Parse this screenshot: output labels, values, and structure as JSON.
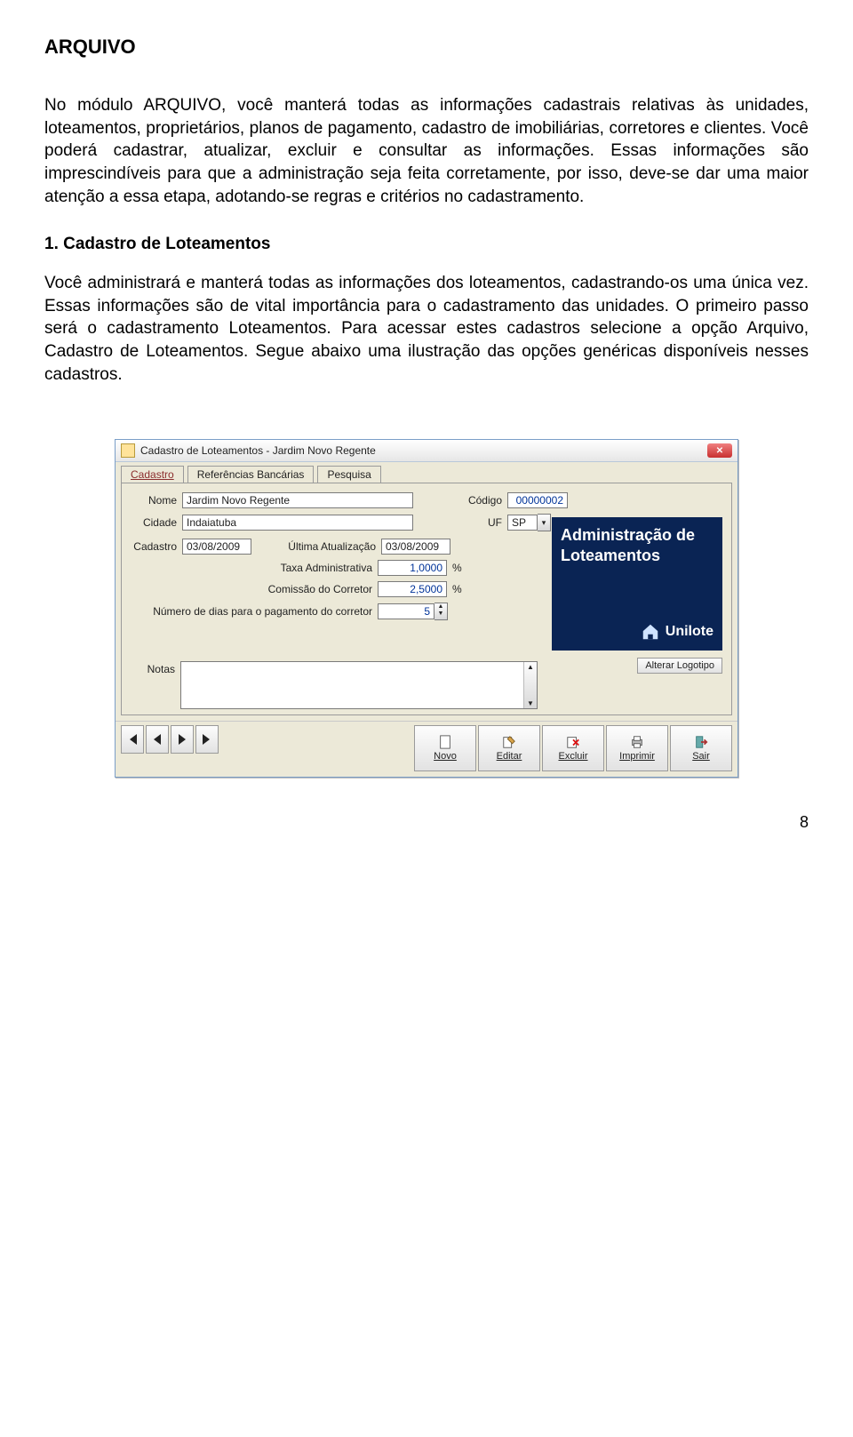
{
  "heading": "ARQUIVO",
  "para1": "No módulo ARQUIVO, você manterá todas as informações cadastrais relativas às unidades, loteamentos, proprietários, planos de pagamento, cadastro de imobiliárias, corretores e clientes. Você poderá cadastrar, atualizar, excluir e consultar as informações. Essas informações são imprescindíveis para que a administração seja feita corretamente, por isso, deve-se dar uma maior atenção a essa etapa, adotando-se regras e critérios no cadastramento.",
  "sub1": "1. Cadastro de Loteamentos",
  "para2": "Você administrará e manterá todas as informações dos loteamentos, cadastrando-os uma única vez. Essas informações são de vital importância para o cadastramento das unidades. O primeiro passo será o cadastramento Loteamentos. Para acessar estes cadastros selecione a opção Arquivo, Cadastro de Loteamentos. Segue abaixo uma ilustração das opções genéricas disponíveis nesses cadastros.",
  "page_no": "8",
  "win": {
    "title": "Cadastro de Loteamentos - Jardim Novo Regente",
    "tabs": {
      "t1": "Cadastro",
      "t2": "Referências Bancárias",
      "t3": "Pesquisa"
    },
    "labels": {
      "nome": "Nome",
      "codigo": "Código",
      "cidade": "Cidade",
      "uf": "UF",
      "cadastro": "Cadastro",
      "ultima": "Última Atualização",
      "taxa": "Taxa Administrativa",
      "comissao": "Comissão do Corretor",
      "numdias": "Número de dias para o pagamento do corretor",
      "notas": "Notas"
    },
    "values": {
      "nome": "Jardim Novo Regente",
      "codigo": "00000002",
      "cidade": "Indaiatuba",
      "uf": "SP",
      "cadastro": "03/08/2009",
      "ultima": "03/08/2009",
      "taxa": "1,0000",
      "comissao": "2,5000",
      "numdias": "5"
    },
    "pct": "%",
    "logo": {
      "line1": "Administração de",
      "line2": "Loteamentos",
      "brand": "Unilote"
    },
    "alter": "Alterar Logotipo",
    "buttons": {
      "novo": "Novo",
      "editar": "Editar",
      "excluir": "Excluir",
      "imprimir": "Imprimir",
      "sair": "Sair"
    }
  }
}
